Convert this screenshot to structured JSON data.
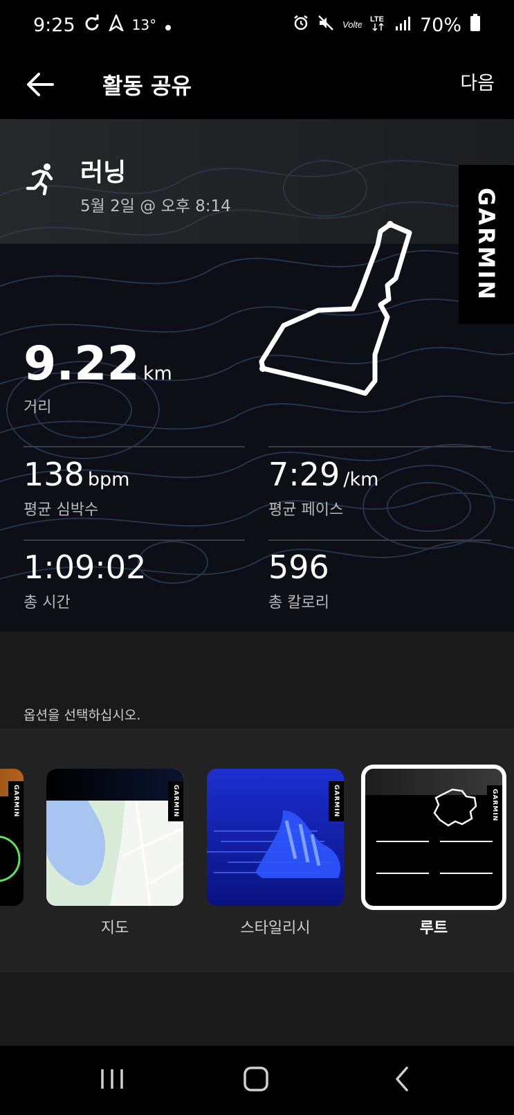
{
  "status_bar": {
    "time": "9:25",
    "temperature": "13°",
    "battery": "70%",
    "icons": [
      "sync-icon",
      "navigation-icon",
      "alarm-icon",
      "mute-icon",
      "volte-icon",
      "lte-icon",
      "signal-icon",
      "battery-icon"
    ]
  },
  "app_bar": {
    "title": "활동 공유",
    "next_label": "다음"
  },
  "activity": {
    "title": "러닝",
    "date": "5월 2일 @ 오후 8:14",
    "brand": "GARMIN",
    "stats": {
      "distance": {
        "value": "9.22",
        "unit": "km",
        "label": "거리"
      },
      "heart_rate": {
        "value": "138",
        "unit": "bpm",
        "label": "평균 심박수"
      },
      "pace": {
        "value": "7:29",
        "unit": "/km",
        "label": "평균 페이스"
      },
      "time": {
        "value": "1:09:02",
        "label": "총 시간"
      },
      "calories": {
        "value": "596",
        "label": "총 칼로리"
      }
    }
  },
  "options": {
    "prompt": "옵션을 선택하십시오.",
    "items": [
      {
        "label": "지도"
      },
      {
        "label": "스타일리시"
      },
      {
        "label": "루트",
        "selected": true
      }
    ]
  },
  "colors": {
    "background": "#1a1a1a",
    "card": "#0c0f15",
    "topo_line": "#2b3a52",
    "map_water": "#a8c4f0",
    "stylish_blue": "#1c2fd0"
  }
}
